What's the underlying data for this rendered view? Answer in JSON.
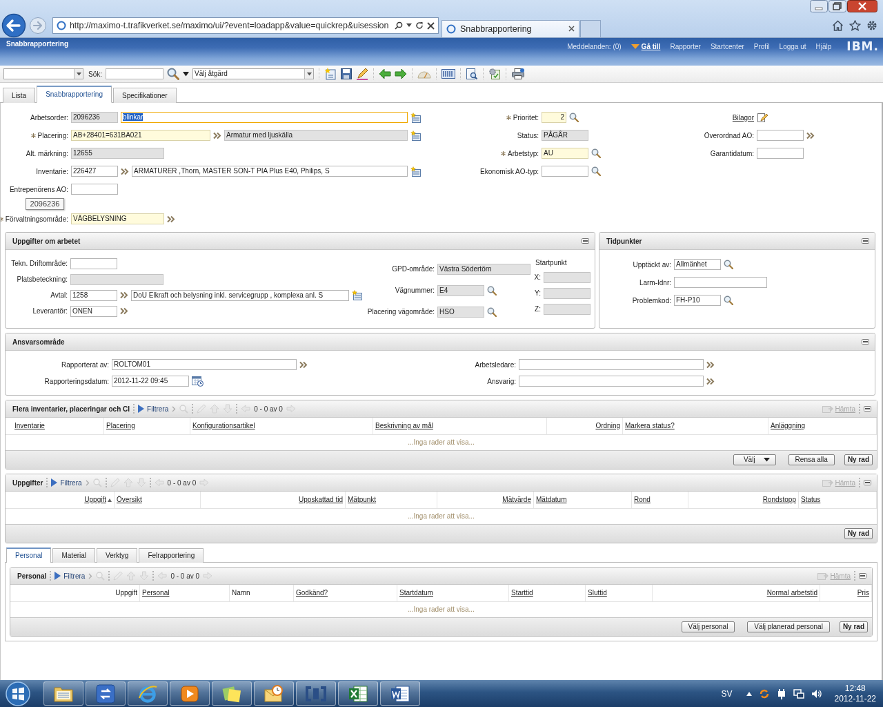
{
  "browser": {
    "url": "http://maximo-t.trafikverket.se/maximo/ui/?event=loadapp&value=quickrep&uisession",
    "tab_title": "Snabbrapportering"
  },
  "header": {
    "app_title": "Snabbrapportering",
    "messages": "Meddelanden: (0)",
    "goto": "Gå till",
    "links": [
      "Rapporter",
      "Startcenter",
      "Profil",
      "Logga ut",
      "Hjälp"
    ],
    "logo": "IBM."
  },
  "toolbar": {
    "search_label": "Sök:",
    "action_placeholder": "Välj åtgärd"
  },
  "tabs": [
    {
      "label": "Lista",
      "selected": false
    },
    {
      "label": "Snabbrapportering",
      "selected": true
    },
    {
      "label": "Specifikationer",
      "selected": false
    }
  ],
  "form": {
    "tooltip": "2096236",
    "columns": [
      [
        {
          "label": "Arbetsorder:",
          "required": false,
          "items": [
            {
              "kind": "code",
              "readonly": true,
              "required": false,
              "focused": false,
              "value": "2096236"
            },
            {
              "kind": "text",
              "readonly": false,
              "required": false,
              "focused": true,
              "value": "blinkar"
            },
            {
              "kind": "menu"
            }
          ]
        },
        {
          "label": "Placering:",
          "required": true,
          "items": [
            {
              "kind": "long",
              "readonly": false,
              "required": true,
              "focused": false,
              "value": "AB+28401=631BA021"
            },
            {
              "kind": "chevron"
            },
            {
              "kind": "text",
              "readonly": true,
              "required": false,
              "focused": false,
              "value": "Armatur med ljuskälla"
            },
            {
              "kind": "menu"
            }
          ]
        },
        {
          "label": "Alt. märkning:",
          "required": false,
          "items": [
            {
              "kind": "name",
              "readonly": true,
              "required": false,
              "focused": false,
              "value": "12655"
            }
          ]
        },
        {
          "label": "Inventarie:",
          "required": false,
          "items": [
            {
              "kind": "code",
              "readonly": false,
              "required": false,
              "focused": false,
              "value": "226427"
            },
            {
              "kind": "chevron"
            },
            {
              "kind": "text",
              "readonly": false,
              "required": false,
              "focused": false,
              "value": "ARMATURER ,Thorn, MASTER SON-T PIA Plus E40, Philips, S"
            },
            {
              "kind": "menu"
            }
          ]
        },
        {
          "label": "Entrepenörens AO:",
          "required": false,
          "items": [
            {
              "kind": "code",
              "readonly": false,
              "required": false,
              "focused": false
            }
          ]
        },
        {
          "label": "Förvaltningsområde:",
          "required": true,
          "items": [
            {
              "kind": "name",
              "readonly": false,
              "required": true,
              "focused": false,
              "value": "VÄGBELYSNING"
            },
            {
              "kind": "chevron"
            }
          ]
        }
      ],
      [
        {
          "label": "Prioritet:",
          "required": true,
          "items": [
            {
              "kind": "num",
              "readonly": false,
              "required": true,
              "focused": false,
              "value": "2"
            },
            {
              "kind": "lookup"
            }
          ]
        },
        {
          "label": "Status:",
          "required": false,
          "items": [
            {
              "kind": "code",
              "readonly": true,
              "required": false,
              "focused": false,
              "value": "PÅGÅR"
            }
          ]
        },
        {
          "label": "Arbetstyp:",
          "required": true,
          "items": [
            {
              "kind": "code",
              "readonly": false,
              "required": true,
              "focused": false,
              "value": "AU"
            },
            {
              "kind": "lookup"
            }
          ]
        },
        {
          "label": "Ekonomisk AO-typ:",
          "required": false,
          "items": [
            {
              "kind": "code",
              "readonly": false,
              "required": false,
              "focused": false
            },
            {
              "kind": "lookup"
            }
          ]
        }
      ],
      [
        {
          "kind": "link",
          "label": "Bilagor",
          "items": [
            {
              "kind": "attach"
            }
          ]
        },
        {
          "label": "Överordnad AO:",
          "required": false,
          "items": [
            {
              "kind": "code",
              "readonly": false,
              "required": false,
              "focused": false
            },
            {
              "kind": "chevron"
            }
          ]
        },
        {
          "label": "Garantidatum:",
          "required": false,
          "items": [
            {
              "kind": "code",
              "readonly": false,
              "required": false,
              "focused": false
            }
          ]
        }
      ]
    ]
  },
  "panels": [
    {
      "title": "Uppgifter om arbetet",
      "columns": [
        [
          {
            "label": "Tekn. Driftområde:",
            "required": false,
            "items": [
              {
                "kind": "code",
                "readonly": false,
                "required": false,
                "focused": false
              }
            ]
          },
          {
            "label": "Platsbeteckning:",
            "required": false,
            "items": [
              {
                "kind": "name",
                "readonly": true,
                "required": false,
                "focused": false
              }
            ]
          },
          {
            "label": "Avtal:",
            "required": false,
            "items": [
              {
                "kind": "code",
                "readonly": false,
                "required": false,
                "focused": false,
                "value": "1258"
              },
              {
                "kind": "chevron"
              },
              {
                "kind": "text",
                "readonly": false,
                "required": false,
                "focused": false,
                "value": "DoU Elkraft och belysning inkl. servicegrupp , komplexa anl. S"
              },
              {
                "kind": "menu"
              }
            ]
          },
          {
            "label": "Leverantör:",
            "required": false,
            "items": [
              {
                "kind": "code",
                "readonly": false,
                "required": false,
                "focused": false,
                "value": "ONEN"
              },
              {
                "kind": "chevron"
              }
            ]
          }
        ],
        [
          {
            "label": "GPD-område:",
            "required": false,
            "items": [
              {
                "kind": "name",
                "readonly": true,
                "required": false,
                "focused": false,
                "value": "Västra Södertörn"
              }
            ]
          },
          {
            "label": "Vägnummer:",
            "required": false,
            "items": [
              {
                "kind": "code",
                "readonly": true,
                "required": false,
                "focused": false,
                "value": "E4"
              },
              {
                "kind": "lookup"
              }
            ]
          },
          {
            "label": "Placering vägområde:",
            "required": false,
            "items": [
              {
                "kind": "code",
                "readonly": true,
                "required": false,
                "focused": false,
                "value": "HSO"
              },
              {
                "kind": "lookup"
              }
            ]
          }
        ],
        [
          {
            "kind": "heading",
            "label": "Startpunkt"
          },
          {
            "label": "X:",
            "required": false,
            "items": [
              {
                "kind": "code",
                "readonly": true,
                "required": false,
                "focused": false
              }
            ]
          },
          {
            "label": "Y:",
            "required": false,
            "items": [
              {
                "kind": "code",
                "readonly": true,
                "required": false,
                "focused": false
              }
            ]
          },
          {
            "label": "Z:",
            "required": false,
            "items": [
              {
                "kind": "code",
                "readonly": true,
                "required": false,
                "focused": false
              }
            ]
          }
        ]
      ]
    },
    {
      "title": "Tidpunkter",
      "columns": [
        [
          {
            "label": "Upptäckt av:",
            "required": false,
            "items": [
              {
                "kind": "code",
                "readonly": false,
                "required": false,
                "focused": false,
                "value": "Allmänhet"
              },
              {
                "kind": "lookup"
              }
            ]
          },
          {
            "label": "Larm-Idnr:",
            "required": false,
            "items": [
              {
                "kind": "name",
                "readonly": false,
                "required": false,
                "focused": false
              }
            ]
          },
          {
            "label": "Problemkod:",
            "required": false,
            "items": [
              {
                "kind": "code",
                "readonly": false,
                "required": false,
                "focused": false,
                "value": "FH-P10"
              },
              {
                "kind": "lookup"
              }
            ]
          }
        ]
      ]
    },
    {
      "title": "Ansvarsområde",
      "columns": [
        [
          {
            "label": "Rapporterat av:",
            "required": false,
            "items": [
              {
                "kind": "wide",
                "readonly": false,
                "required": false,
                "focused": false,
                "value": "ROLTOM01"
              },
              {
                "kind": "chevron"
              }
            ]
          },
          {
            "label": "Rapporteringsdatum:",
            "required": false,
            "items": [
              {
                "kind": "date",
                "readonly": false,
                "required": false,
                "focused": false,
                "value": "2012-11-22 09:45"
              },
              {
                "kind": "calendar"
              }
            ]
          }
        ],
        [
          {
            "label": "Arbetsledare:",
            "required": false,
            "items": [
              {
                "kind": "wide",
                "readonly": false,
                "required": false,
                "focused": false
              },
              {
                "kind": "chevron"
              }
            ]
          },
          {
            "label": "Ansvarig:",
            "required": false,
            "items": [
              {
                "kind": "wide",
                "readonly": false,
                "required": false,
                "focused": false
              },
              {
                "kind": "chevron"
              }
            ]
          }
        ]
      ]
    }
  ],
  "tables": [
    {
      "title": "Flera inventarier, placeringar och CI",
      "filter": "Filtrera",
      "count": "0 - 0 av 0",
      "fetch": "Hämta",
      "empty": "...Inga rader att visa...",
      "columns": [
        {
          "label": "Inventarie",
          "sortable": true,
          "align_right": false
        },
        {
          "label": "Placering",
          "sortable": true,
          "align_right": false
        },
        {
          "label": "Konfigurationsartikel",
          "sortable": true,
          "align_right": false
        },
        {
          "label": "Beskrivning av mål",
          "sortable": true,
          "align_right": false
        },
        {
          "label": "Ordning",
          "sortable": true,
          "align_right": true
        },
        {
          "label": "Markera status?",
          "sortable": true,
          "align_right": false
        },
        {
          "label": "Anläggning",
          "sortable": true,
          "align_right": false
        }
      ],
      "buttons": [
        {
          "label": "Välj",
          "kind": "dropdown"
        },
        {
          "label": "Rensa alla",
          "kind": "normal"
        },
        {
          "label": "Ny rad",
          "kind": "primary"
        }
      ]
    },
    {
      "title": "Uppgifter",
      "filter": "Filtrera",
      "count": "0 - 0 av 0",
      "fetch": "Hämta",
      "empty": "...Inga rader att visa...",
      "columns": [
        {
          "label": "Uppgift",
          "sortable": true,
          "align_right": true,
          "sorted": true
        },
        {
          "label": "Översikt",
          "sortable": true,
          "align_right": false,
          "sorted": false
        },
        {
          "label": "Uppskattad tid",
          "sortable": true,
          "align_right": true,
          "sorted": false
        },
        {
          "label": "Mätpunkt",
          "sortable": true,
          "align_right": false,
          "sorted": false
        },
        {
          "label": "Mätvärde",
          "sortable": true,
          "align_right": true,
          "sorted": false
        },
        {
          "label": "Mätdatum",
          "sortable": true,
          "align_right": false,
          "sorted": false
        },
        {
          "label": "Rond",
          "sortable": true,
          "align_right": false,
          "sorted": false
        },
        {
          "label": "Rondstopp",
          "sortable": true,
          "align_right": true,
          "sorted": false
        },
        {
          "label": "Status",
          "sortable": true,
          "align_right": false,
          "sorted": false
        }
      ],
      "buttons": [
        {
          "label": "Ny rad",
          "kind": "primary"
        }
      ]
    },
    {
      "title": "Personal",
      "filter": "Filtrera",
      "count": "0 - 0 av 0",
      "fetch": "Hämta",
      "empty": "...Inga rader att visa...",
      "columns": [
        {
          "label": "Uppgift",
          "sortable": false,
          "align_right": true
        },
        {
          "label": "Personal",
          "sortable": true,
          "align_right": false
        },
        {
          "label": "Namn",
          "sortable": false,
          "align_right": false
        },
        {
          "label": "Godkänd?",
          "sortable": true,
          "align_right": false
        },
        {
          "label": "Startdatum",
          "sortable": true,
          "align_right": false
        },
        {
          "label": "Starttid",
          "sortable": true,
          "align_right": false
        },
        {
          "label": "Sluttid",
          "sortable": true,
          "align_right": false
        },
        {
          "label": "Normal arbetstid",
          "sortable": true,
          "align_right": true
        },
        {
          "label": "Pris",
          "sortable": true,
          "align_right": true
        }
      ],
      "buttons": [
        {
          "label": "Välj personal",
          "kind": "normal"
        },
        {
          "label": "Välj planerad personal",
          "kind": "normal"
        },
        {
          "label": "Ny rad",
          "kind": "primary"
        }
      ]
    }
  ],
  "subtabs": [
    {
      "label": "Personal",
      "selected": true
    },
    {
      "label": "Material",
      "selected": false
    },
    {
      "label": "Verktyg",
      "selected": false
    },
    {
      "label": "Felrapportering",
      "selected": false
    }
  ],
  "taskbar": {
    "apps": [
      {
        "kind": "folder"
      },
      {
        "kind": "remote"
      },
      {
        "kind": "browser"
      },
      {
        "kind": "media"
      },
      {
        "kind": "notes"
      },
      {
        "kind": "mail"
      },
      {
        "kind": "console"
      },
      {
        "kind": "sheet"
      },
      {
        "kind": "doc"
      }
    ],
    "language": "SV",
    "time": "12:48",
    "date": "2012-11-22"
  }
}
